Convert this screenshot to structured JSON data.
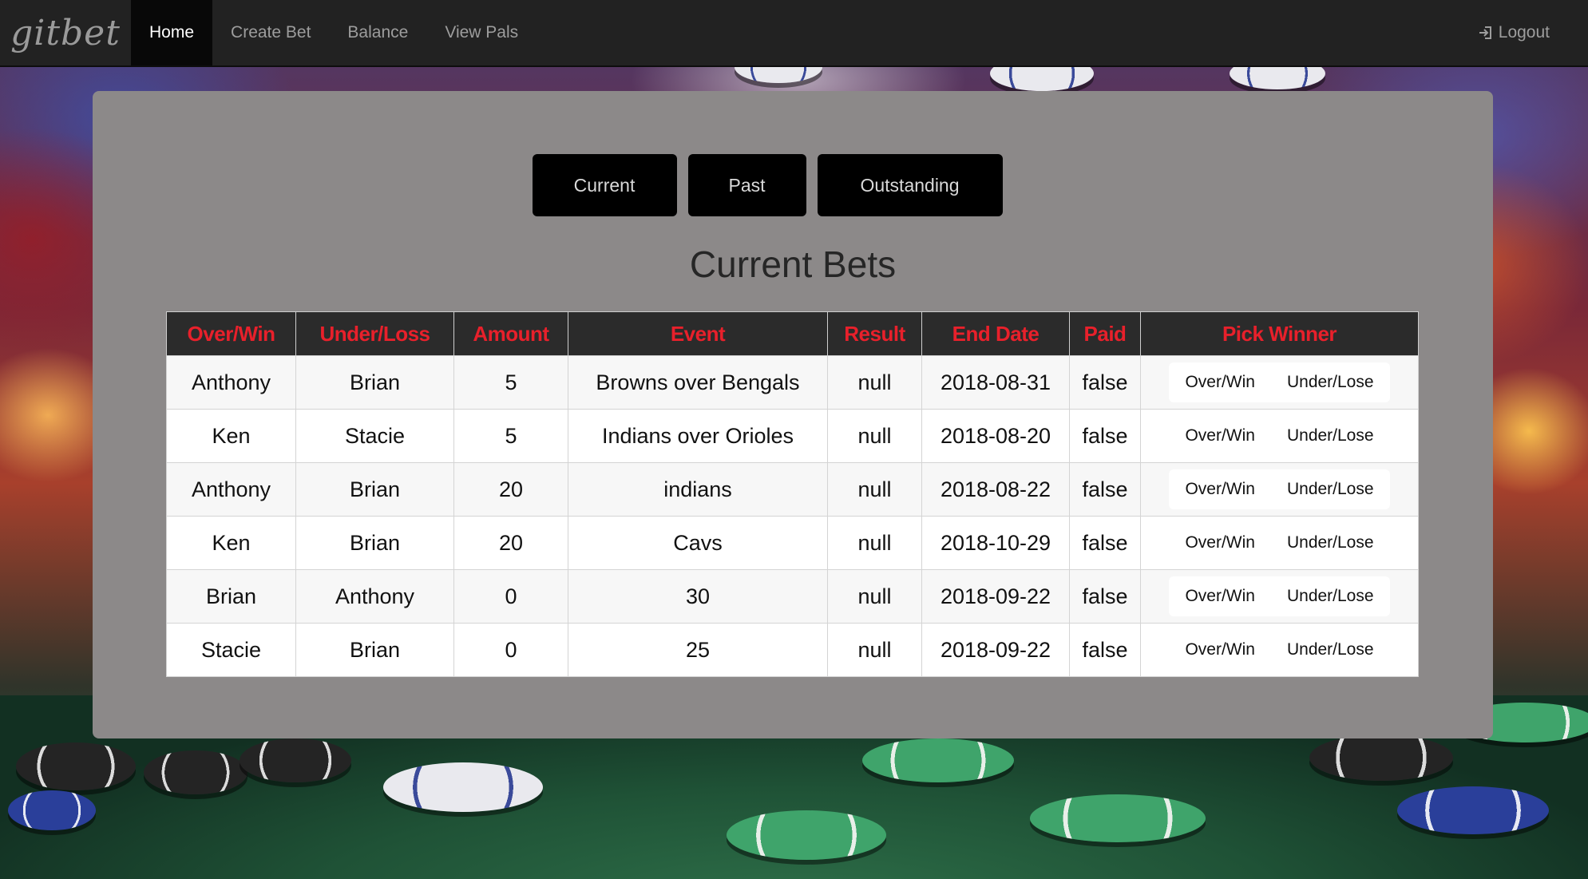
{
  "nav": {
    "brand": "gitbet",
    "items": [
      {
        "label": "Home",
        "active": true
      },
      {
        "label": "Create Bet",
        "active": false
      },
      {
        "label": "Balance",
        "active": false
      },
      {
        "label": "View Pals",
        "active": false
      }
    ],
    "logout_label": "Logout",
    "logout_icon": "login-icon"
  },
  "tabs": {
    "current": "Current",
    "past": "Past",
    "outstanding": "Outstanding"
  },
  "main": {
    "title": "Current Bets"
  },
  "table": {
    "headers": [
      "Over/Win",
      "Under/Loss",
      "Amount",
      "Event",
      "Result",
      "End Date",
      "Paid",
      "Pick Winner"
    ],
    "pick_labels": {
      "over": "Over/Win",
      "under": "Under/Lose"
    },
    "rows": [
      {
        "over": "Anthony",
        "under": "Brian",
        "amount": "5",
        "event": "Browns over Bengals",
        "result": "null",
        "end_date": "2018-08-31",
        "paid": "false"
      },
      {
        "over": "Ken",
        "under": "Stacie",
        "amount": "5",
        "event": "Indians over Orioles",
        "result": "null",
        "end_date": "2018-08-20",
        "paid": "false"
      },
      {
        "over": "Anthony",
        "under": "Brian",
        "amount": "20",
        "event": "indians",
        "result": "null",
        "end_date": "2018-08-22",
        "paid": "false"
      },
      {
        "over": "Ken",
        "under": "Brian",
        "amount": "20",
        "event": "Cavs",
        "result": "null",
        "end_date": "2018-10-29",
        "paid": "false"
      },
      {
        "over": "Brian",
        "under": "Anthony",
        "amount": "0",
        "event": "30",
        "result": "null",
        "end_date": "2018-09-22",
        "paid": "false"
      },
      {
        "over": "Stacie",
        "under": "Brian",
        "amount": "0",
        "event": "25",
        "result": "null",
        "end_date": "2018-09-22",
        "paid": "false"
      }
    ]
  },
  "colors": {
    "navbar": "#222222",
    "panel": "#8c8989",
    "header_bg": "#2b2b2b",
    "header_text": "#e8202b",
    "tab_button": "#000000"
  }
}
